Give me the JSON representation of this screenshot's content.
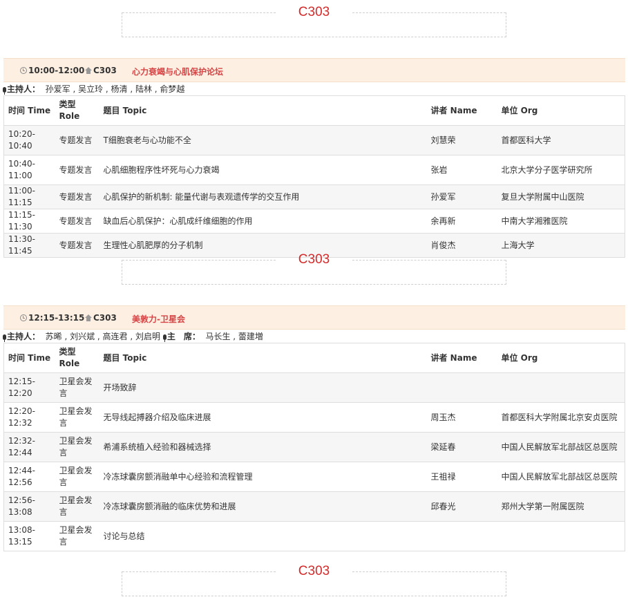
{
  "banners": [
    "C303",
    "C303",
    "C303"
  ],
  "labels": {
    "chair": "主持人：",
    "chairman": "主　席："
  },
  "columns": {
    "time": "时间 Time",
    "role": "类型 Role",
    "topic": "题目 Topic",
    "speaker": "讲者 Name",
    "org": "单位 Org"
  },
  "sessions": [
    {
      "time": "10:00-12:00",
      "room": "C303",
      "title": "心力衰竭与心肌保护论坛",
      "chairs": "孙爱军 , 吴立玲 , 杨清 , 陆林 , 俞梦越",
      "rows": [
        {
          "time": "10:20-10:40",
          "role": "专题发言",
          "topic": "T细胞衰老与心功能不全",
          "speaker": "刘慧荣",
          "org": "首都医科大学"
        },
        {
          "time": "10:40-11:00",
          "role": "专题发言",
          "topic": "心肌细胞程序性坏死与心力衰竭",
          "speaker": "张岩",
          "org": "北京大学分子医学研究所"
        },
        {
          "time": "11:00-11:15",
          "role": "专题发言",
          "topic": "心肌保护的新机制: 能量代谢与表观遗传学的交互作用",
          "speaker": "孙爱军",
          "org": "复旦大学附属中山医院"
        },
        {
          "time": "11:15-11:30",
          "role": "专题发言",
          "topic": "缺血后心肌保护：心肌成纤维细胞的作用",
          "speaker": "余再新",
          "org": "中南大学湘雅医院"
        },
        {
          "time": "11:30-11:45",
          "role": "专题发言",
          "topic": "生理性心肌肥厚的分子机制",
          "speaker": "肖俊杰",
          "org": "上海大学"
        }
      ]
    },
    {
      "time": "12:15-13:15",
      "room": "C303",
      "title": "美敦力-卫星会",
      "chairs": "苏晞 , 刘兴斌 , 高连君 , 刘启明",
      "chairman": "马长生 , 蕾建増",
      "rows": [
        {
          "time": "12:15-12:20",
          "role": "卫星会发言",
          "topic": "开场致辞",
          "speaker": "",
          "org": ""
        },
        {
          "time": "12:20-12:32",
          "role": "卫星会发言",
          "topic": "无导线起搏器介绍及临床进展",
          "speaker": "周玉杰",
          "org": "首都医科大学附属北京安贞医院"
        },
        {
          "time": "12:32-12:44",
          "role": "卫星会发言",
          "topic": "希浦系统植入经验和器械选择",
          "speaker": "梁延春",
          "org": "中国人民解放军北部战区总医院"
        },
        {
          "time": "12:44-12:56",
          "role": "卫星会发言",
          "topic": "冷冻球囊房颤消融单中心经验和流程管理",
          "speaker": "王祖禄",
          "org": "中国人民解放军北部战区总医院"
        },
        {
          "time": "12:56-13:08",
          "role": "卫星会发言",
          "topic": "冷冻球囊房颤消融的临床优势和进展",
          "speaker": "邱春光",
          "org": "郑州大学第一附属医院"
        },
        {
          "time": "13:08-13:15",
          "role": "卫星会发言",
          "topic": "讨论与总结",
          "speaker": "",
          "org": ""
        }
      ]
    }
  ]
}
